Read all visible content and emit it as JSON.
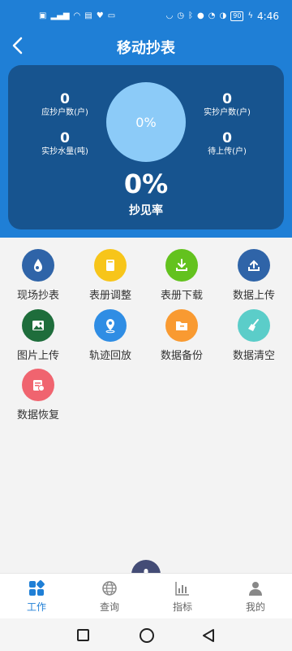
{
  "status_bar": {
    "time": "4:46",
    "battery": "90"
  },
  "header": {
    "title": "移动抄表"
  },
  "stats": {
    "should_read_households": {
      "value": "0",
      "label": "应抄户数(户)"
    },
    "actual_water_volume": {
      "value": "0",
      "label": "实抄水量(吨)"
    },
    "actual_read_households": {
      "value": "0",
      "label": "实抄户数(户)"
    },
    "pending_upload": {
      "value": "0",
      "label": "待上传(户)"
    },
    "circle_percent": "0%",
    "rate_value": "0%",
    "rate_label": "抄见率"
  },
  "menu": [
    {
      "label": "现场抄表",
      "icon": "water-drop-icon",
      "color": "#2f64a8"
    },
    {
      "label": "表册调整",
      "icon": "book-icon",
      "color": "#f7c51a"
    },
    {
      "label": "表册下载",
      "icon": "download-icon",
      "color": "#63c21e"
    },
    {
      "label": "数据上传",
      "icon": "upload-icon",
      "color": "#2f64a8"
    },
    {
      "label": "图片上传",
      "icon": "image-icon",
      "color": "#1e6d3b"
    },
    {
      "label": "轨迹回放",
      "icon": "location-pin-icon",
      "color": "#2f8de4"
    },
    {
      "label": "数据备份",
      "icon": "folder-icon",
      "color": "#f99a31"
    },
    {
      "label": "数据清空",
      "icon": "broom-icon",
      "color": "#5bcdc9"
    },
    {
      "label": "数据恢复",
      "icon": "restore-icon",
      "color": "#f0646f"
    }
  ],
  "tabs": [
    {
      "label": "工作",
      "icon": "grid-icon"
    },
    {
      "label": "查询",
      "icon": "globe-icon"
    },
    {
      "label": "指标",
      "icon": "chart-icon"
    },
    {
      "label": "我的",
      "icon": "user-icon"
    }
  ],
  "colors": {
    "primary": "#1f7fd6",
    "card": "#17548f",
    "circle": "#8ccbf8"
  }
}
